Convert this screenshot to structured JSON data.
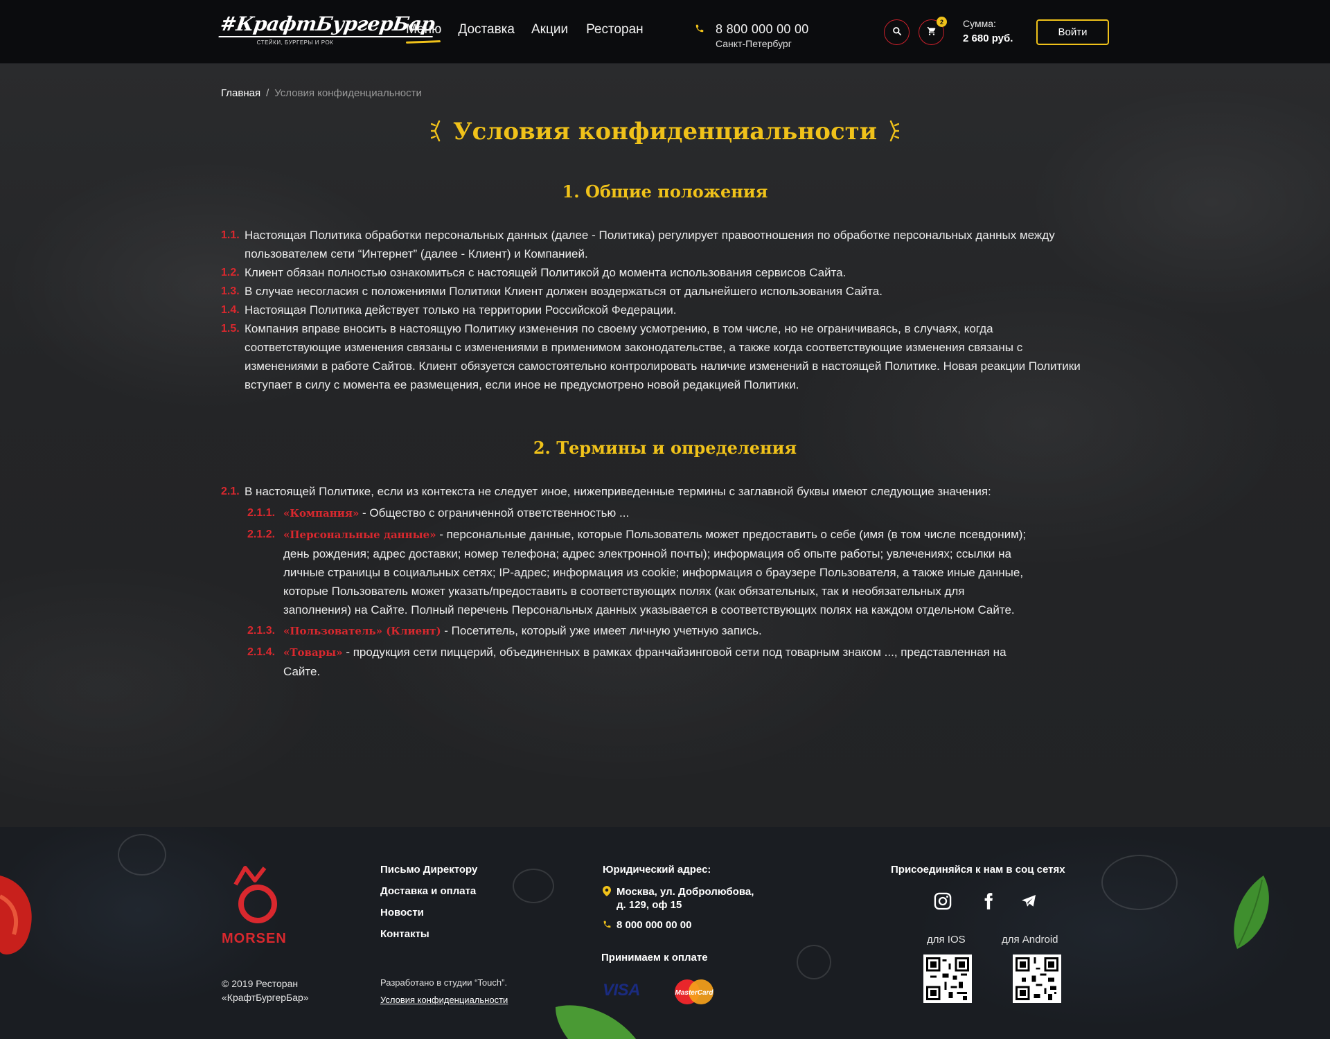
{
  "header": {
    "logo": {
      "main": "#КрафтБургерБар",
      "sub": "СТЕЙКИ, БУРГЕРЫ И РОК"
    },
    "nav": [
      "Меню",
      "Доставка",
      "Акции",
      "Ресторан"
    ],
    "phone": "8 800 000 00 00",
    "city": "Санкт-Петербург",
    "cart_count": "2",
    "sum_label": "Сумма:",
    "sum_value": "2 680 руб.",
    "login_label": "Войти"
  },
  "breadcrumb": {
    "home": "Главная",
    "separator": "/",
    "current": "Условия конфиденциальности"
  },
  "page_title": "Условия конфиденциальности",
  "sections": [
    {
      "title": "1. Общие положения",
      "items": [
        {
          "num": "1.1.",
          "text": "Настоящая Политика обработки персональных данных (далее - Политика) регулирует правоотношения по обработке персональных данных между пользователем сети “Интернет” (далее - Клиент) и Компанией."
        },
        {
          "num": "1.2.",
          "text": "Клиент обязан полностью ознакомиться с настоящей Политикой до момента использования сервисов Сайта."
        },
        {
          "num": "1.3.",
          "text": "В случае несогласия с положениями Политики Клиент должен воздержаться от дальнейшего использования Сайта."
        },
        {
          "num": "1.4.",
          "text": "Настоящая Политика действует только на территории Российской Федерации."
        },
        {
          "num": "1.5.",
          "text": "Компания вправе вносить в настоящую Политику изменения по своему усмотрению, в том числе, но не ограничиваясь, в случаях, когда соответствующие изменения связаны с изменениями в применимом законодательстве, а также когда соответствующие изменения связаны с изменениями в работе Сайтов. Клиент обязуется самостоятельно контролировать наличие изменений в настоящей Политике. Новая реакции Политики вступает в силу с момента ее размещения, если иное не предусмотрено новой редакцией Политики."
        }
      ]
    },
    {
      "title": "2. Термины и определения",
      "items": [
        {
          "num": "2.1.",
          "text": "В настоящей Политике, если из контекста не следует иное, нижеприведенные термины с заглавной буквы имеют следующие значения:"
        }
      ],
      "subitems": [
        {
          "num": "2.1.1.",
          "term": "«Компания»",
          "text": " - Общество с ограниченной ответственностью ..."
        },
        {
          "num": "2.1.2.",
          "term": "«Персональные данные»",
          "text": " -  персональные данные, которые Пользователь может предоставить о себе (имя (в том числе псевдоним); день рождения; адрес доставки; номер телефона; адрес электронной почты); информация об опыте работы; увлечениях; ссылки на личные страницы в социальных сетях; IP-адрес; информация из cookie; информация о браузере Пользователя, а также иные данные, которые Пользователь может указать/предоставить в соответствующих полях (как обязательных, так и необязательных для заполнения) на Сайте. Полный перечень Персональных данных указывается в соответствующих полях на каждом отдельном Сайте."
        },
        {
          "num": "2.1.3.",
          "term": "«Пользователь» (Клиент)",
          "text": " -  Посетитель, который уже имеет личную учетную запись."
        },
        {
          "num": "2.1.4.",
          "term": "«Товары»",
          "text": " - продукция сети пиццерий, объединенных в рамках франчайзинговой сети под товарным знаком  ..., представленная на Сайте."
        }
      ]
    }
  ],
  "footer": {
    "brand": "MORSEN",
    "copyright_line1": "© 2019 Ресторан",
    "copyright_line2": "«КрафтБургерБар»",
    "links": [
      "Письмо Директору",
      "Доставка и оплата",
      "Новости",
      "Контакты"
    ],
    "developed_by": "Разработано в студии “Touch”.",
    "privacy_link": "Условия конфиденциальности",
    "legal_address_title": "Юридический адрес:",
    "address_line1": "Москва, ул. Добролюбова,",
    "address_line2": "д. 129, оф 15",
    "phone": "8 000 000 00 00",
    "payment_title": "Принимаем к оплате",
    "payment_methods": [
      "VISA",
      "MasterCard"
    ],
    "social_title": "Присоединяйся к нам в соц сетях",
    "social_icons": [
      "instagram-icon",
      "facebook-icon",
      "telegram-icon"
    ],
    "ios_label": "для IOS",
    "android_label": "для Android"
  },
  "colors": {
    "accent_yellow": "#f0c21a",
    "accent_red": "#d9282e",
    "header_bg": "#0b0c0e",
    "board_bg": "#242527"
  }
}
